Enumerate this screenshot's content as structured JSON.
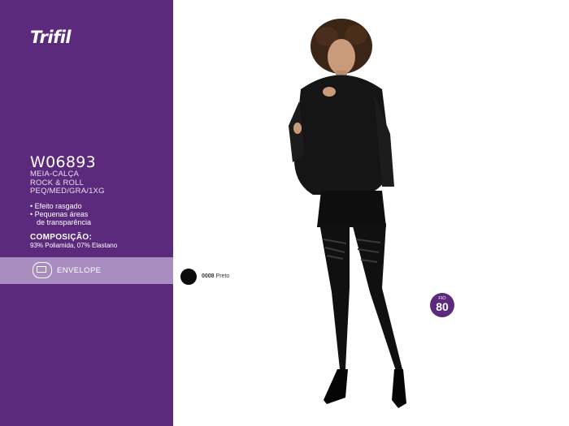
{
  "brand": {
    "name": "Trifil"
  },
  "product": {
    "code": "W06893",
    "name_line1": "MEIA-CALÇA",
    "name_line2": "ROCK & ROLL",
    "sizes": "PEQ/MED/GRA/1XG"
  },
  "features": [
    "• Efeito rasgado",
    "• Pequenas áreas",
    "de transparência"
  ],
  "composition": {
    "title": "COMPOSIÇÃO:",
    "value": "93% Poliamida, 07% Elastano"
  },
  "packaging": {
    "label": "ENVELOPE",
    "icon": "envelope-pack-icon"
  },
  "color_option": {
    "code": "0008",
    "name": "Preto",
    "hex": "#0a0a0a"
  },
  "fio_badge": {
    "label": "FIO",
    "value": "80"
  },
  "colors": {
    "sidebar": "#5b2a7d",
    "pack_bar": "#a98cc0"
  }
}
